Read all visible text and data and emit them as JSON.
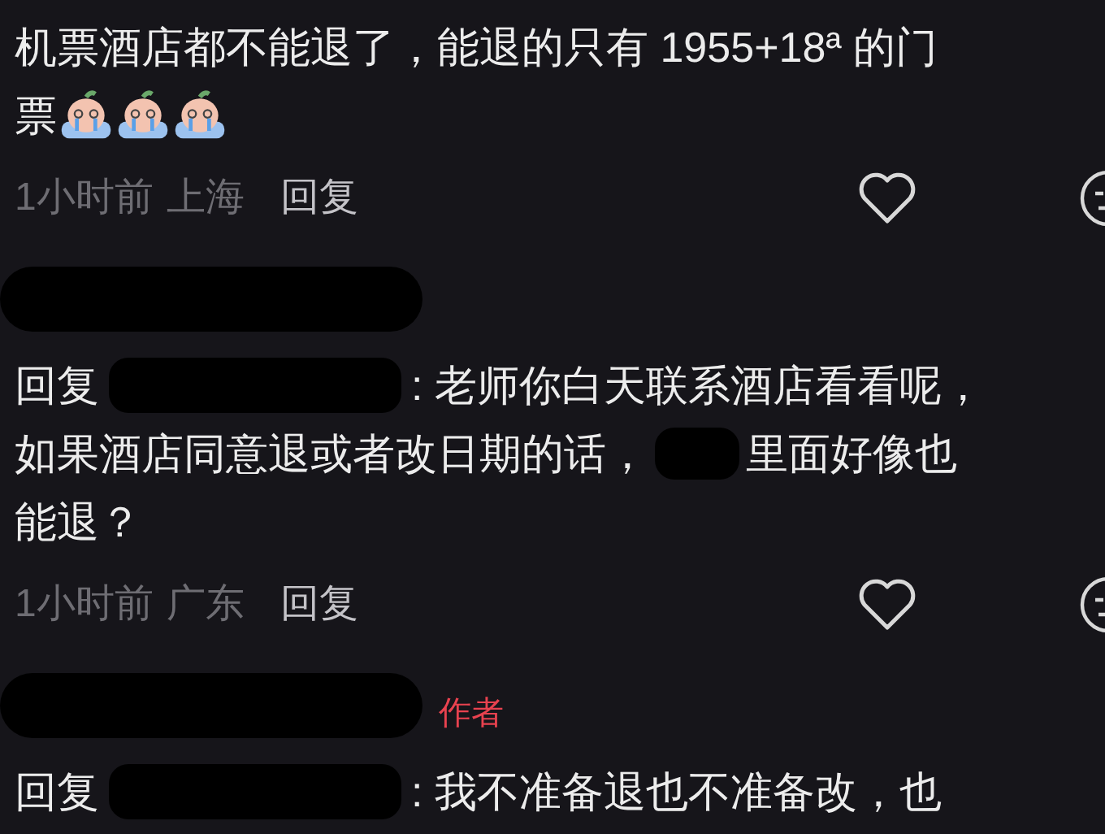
{
  "comments": [
    {
      "kind": "comment",
      "lines": [
        [
          {
            "kind": "text",
            "text": "机票酒店都不能退了，能退的只有 1955+18ª 的门"
          }
        ],
        [
          {
            "kind": "text",
            "text": "票"
          },
          {
            "kind": "emoji"
          },
          {
            "kind": "emoji"
          },
          {
            "kind": "emoji"
          }
        ]
      ],
      "time": "1小时前",
      "location": "上海",
      "reply": "回复"
    },
    {
      "kind": "comment",
      "header": {
        "kind": "redacted_name"
      },
      "lines": [
        [
          {
            "kind": "text",
            "text": "回复"
          },
          {
            "kind": "redaction"
          },
          {
            "kind": "text",
            "text": ": 老师你白天联系酒店看看呢，"
          }
        ],
        [
          {
            "kind": "text",
            "text": "如果酒店同意退或者改日期的话，"
          },
          {
            "kind": "redaction_short"
          },
          {
            "kind": "text",
            "text": "里面好像也"
          }
        ],
        [
          {
            "kind": "text",
            "text": "能退？"
          }
        ]
      ],
      "time": "1小时前",
      "location": "广东",
      "reply": "回复"
    },
    {
      "kind": "comment",
      "header": {
        "kind": "redacted_name",
        "badge": "作者"
      },
      "lines": [
        [
          {
            "kind": "text",
            "text": "回复"
          },
          {
            "kind": "redaction"
          },
          {
            "kind": "text",
            "text": ": 我不准备退也不准备改，也"
          }
        ]
      ]
    }
  ]
}
